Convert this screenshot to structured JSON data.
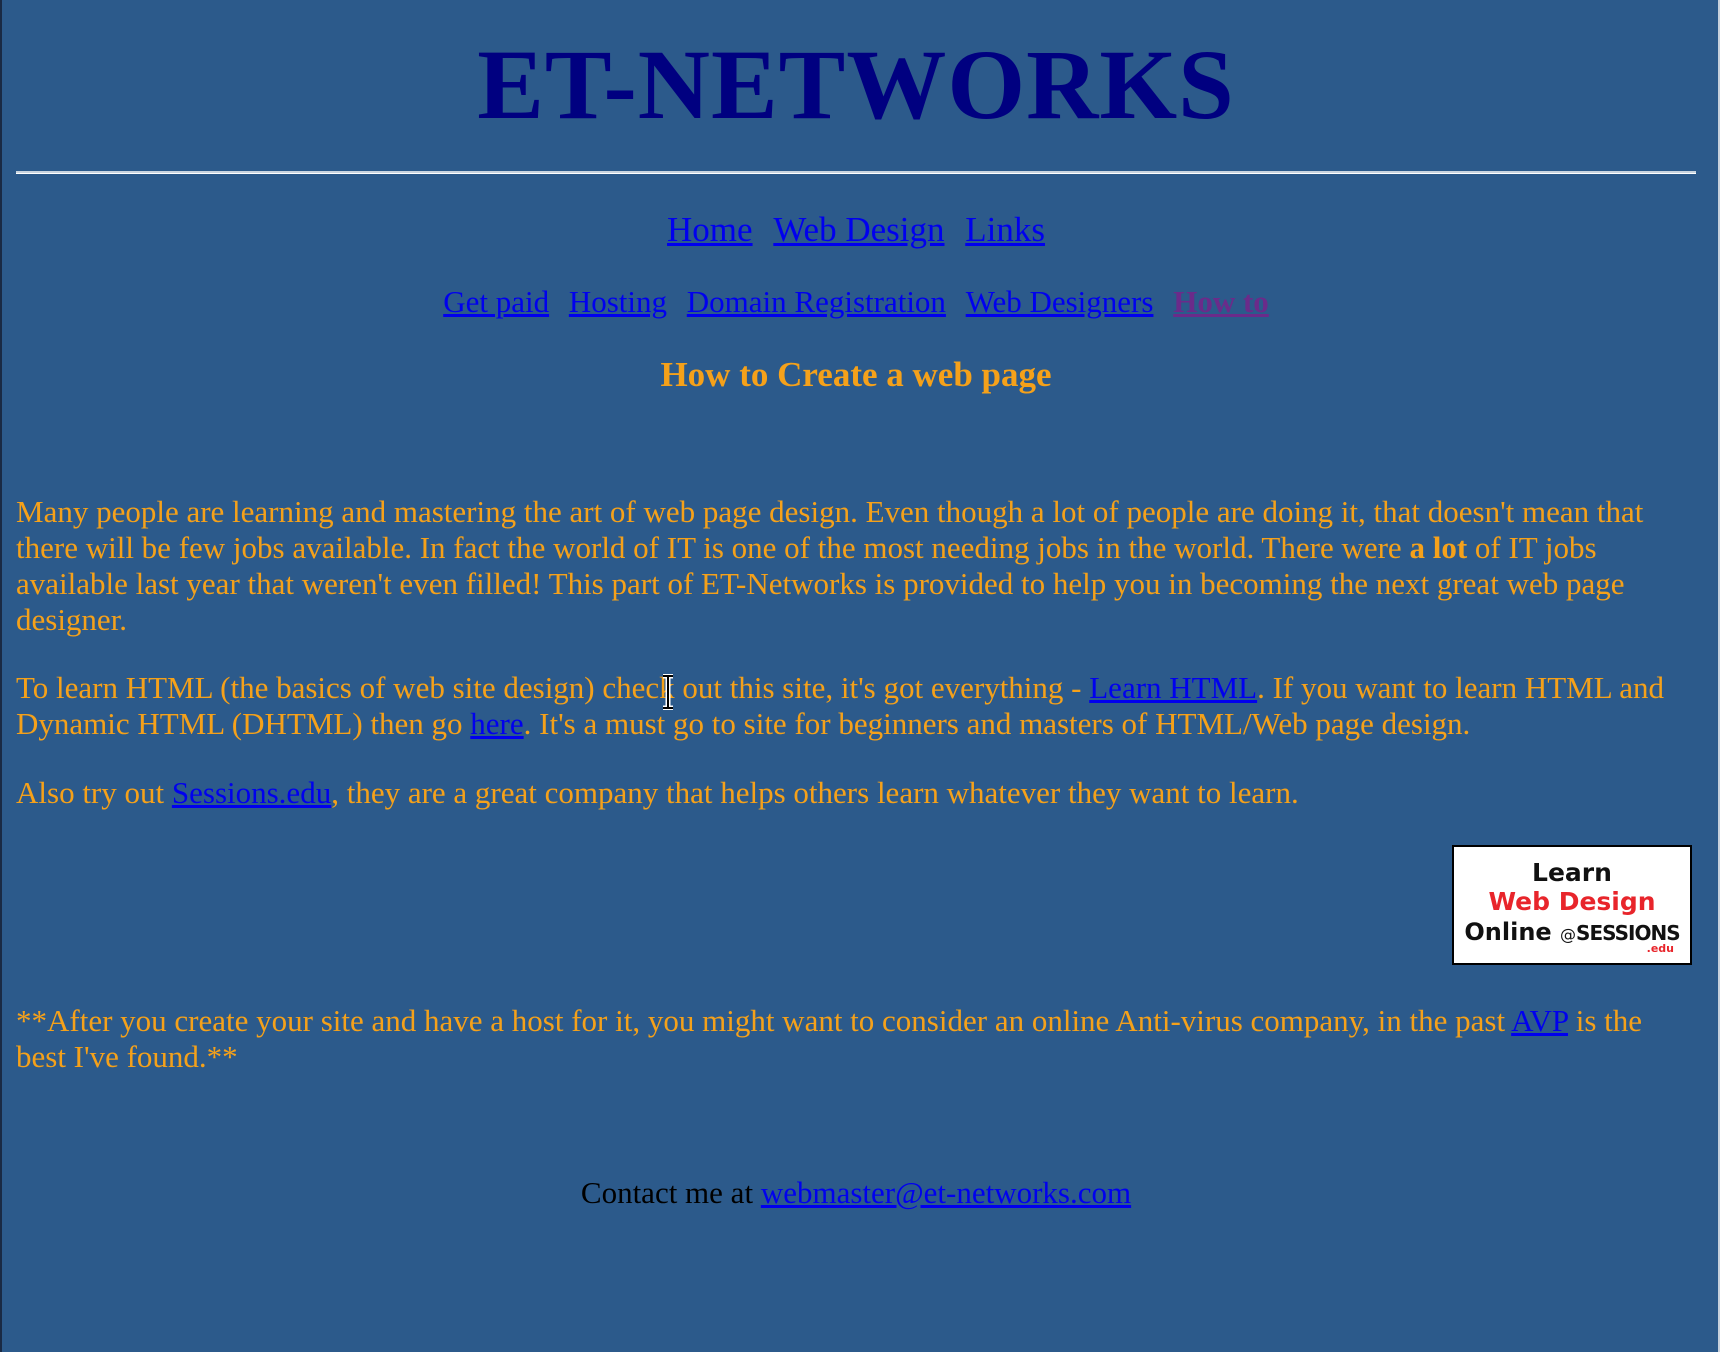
{
  "site": {
    "title": "ET-NETWORKS"
  },
  "nav_main": [
    "Home",
    "Web Design",
    "Links"
  ],
  "nav_sub": [
    "Get paid",
    "Hosting",
    "Domain Registration",
    "Web Designers",
    "How to"
  ],
  "page_heading": "How to Create a web page",
  "p1": {
    "t1": "Many people are learning and mastering the art of web page design.  Even though a lot of people are doing it, that doesn't mean that there will be few jobs available.  In fact the world of IT is one of the most needing jobs in the world.  There were ",
    "bold": "a lot",
    "t2": " of IT jobs available last year that weren't even filled!  This part of ET-Networks is provided to help you in becoming the next great web page designer."
  },
  "p2": {
    "t1": "To learn HTML (the basics of web site design) check out this site, it's got everything - ",
    "link1": "Learn HTML",
    "t2": ".  If you want to learn HTML and Dynamic HTML (DHTML) then go ",
    "link2": "here",
    "t3": ".  It's a must go to site for beginners and masters of HTML/Web page design."
  },
  "p3": {
    "t1": "Also try out ",
    "link": "Sessions.edu",
    "t2": ", they are a great company that helps others learn whatever they want to learn."
  },
  "banner": {
    "line1": "Learn",
    "line2": "Web Design",
    "line3": "Online",
    "at": "@",
    "brand": "SESSIONS",
    "brand_suffix": ".edu"
  },
  "p4": {
    "t1": "**After you create your site and have a host for it, you might want to consider an online Anti-virus company, in the past ",
    "link": "AVP",
    "t2": " is the best I've found.**"
  },
  "contact": {
    "prefix": "Contact me at ",
    "email": "webmaster@et-networks.com"
  },
  "colors": {
    "background": "#2c5a8b",
    "title": "#000080",
    "body_text": "#f5a11a",
    "link": "#0000ee",
    "visited_link": "#6b2b8a"
  }
}
